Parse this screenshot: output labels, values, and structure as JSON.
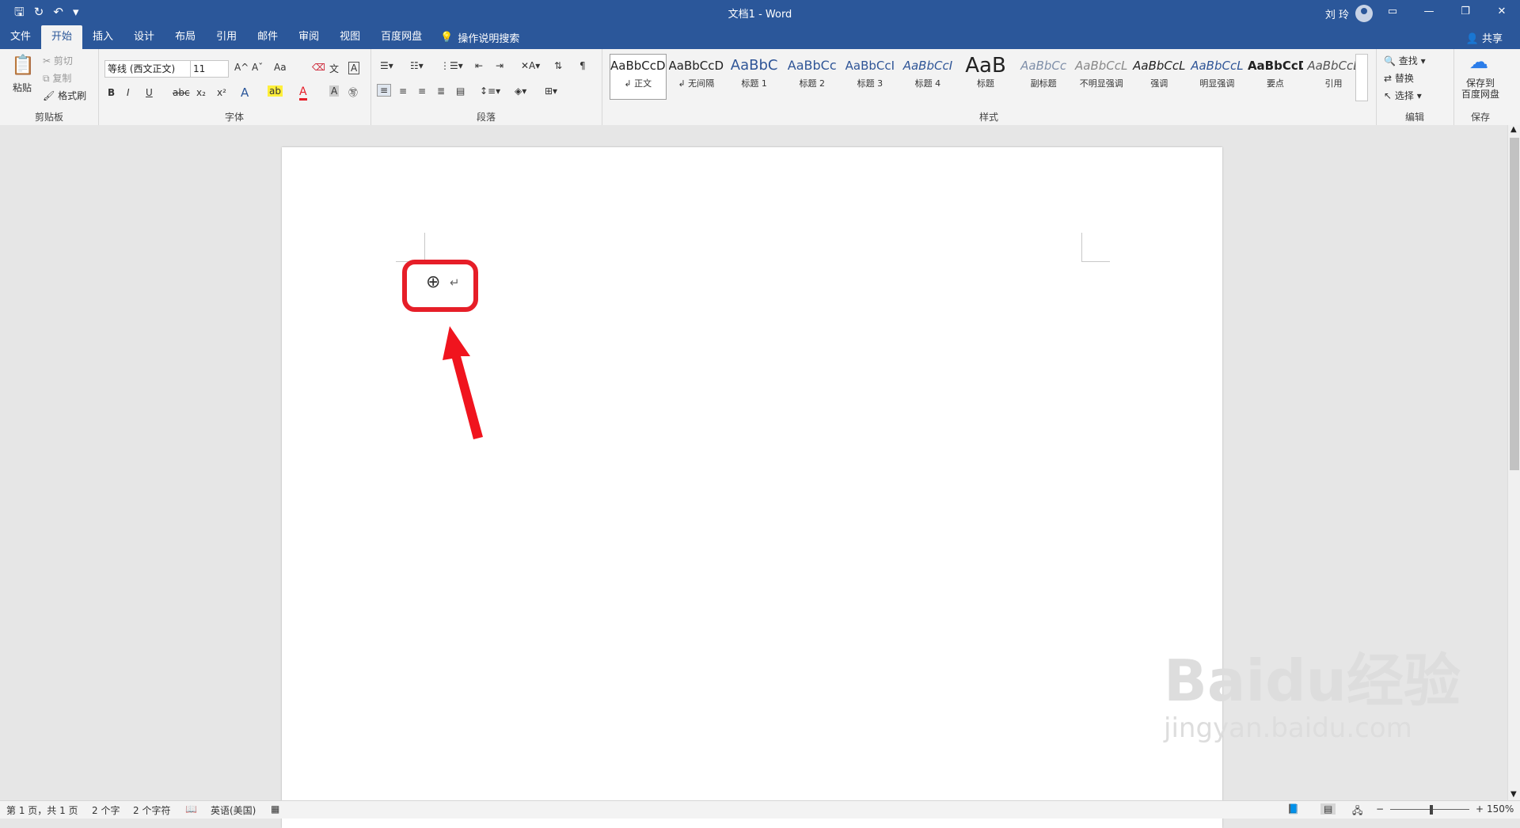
{
  "titlebar": {
    "title": "文档1  -  Word",
    "user": "刘 玲",
    "qat_icons": [
      "save-icon",
      "redo-icon",
      "undo-icon",
      "customize-icon"
    ]
  },
  "tabs": [
    {
      "label": "文件"
    },
    {
      "label": "开始",
      "active": true
    },
    {
      "label": "插入"
    },
    {
      "label": "设计"
    },
    {
      "label": "布局"
    },
    {
      "label": "引用"
    },
    {
      "label": "邮件"
    },
    {
      "label": "审阅"
    },
    {
      "label": "视图"
    },
    {
      "label": "百度网盘"
    }
  ],
  "tell_me": "操作说明搜索",
  "share": "共享",
  "ribbon": {
    "clipboard": {
      "label": "剪贴板",
      "paste": "粘贴",
      "cut": "剪切",
      "copy": "复制",
      "format_painter": "格式刷"
    },
    "font": {
      "label": "字体",
      "font_name": "等线 (西文正文)",
      "font_size": "11",
      "bold": "B",
      "italic": "I",
      "underline": "U",
      "strike": "abc",
      "subscript": "x₂",
      "superscript": "x²",
      "grow": "A^",
      "shrink": "Aˇ",
      "case": "Aa"
    },
    "paragraph": {
      "label": "段落"
    },
    "styles": {
      "label": "样式",
      "items": [
        {
          "sample": "AaBbCcD",
          "name": "↲ 正文",
          "selected": true
        },
        {
          "sample": "AaBbCcD",
          "name": "↲ 无间隔"
        },
        {
          "sample": "AaBbC",
          "name": "标题 1"
        },
        {
          "sample": "AaBbCc",
          "name": "标题 2"
        },
        {
          "sample": "AaBbCcI",
          "name": "标题 3"
        },
        {
          "sample": "AaBbCcI",
          "name": "标题 4"
        },
        {
          "sample": "AaB",
          "name": "标题"
        },
        {
          "sample": "AaBbCc",
          "name": "副标题"
        },
        {
          "sample": "AaBbCcL",
          "name": "不明显强调"
        },
        {
          "sample": "AaBbCcL",
          "name": "强调"
        },
        {
          "sample": "AaBbCcL",
          "name": "明显强调"
        },
        {
          "sample": "AaBbCcD",
          "name": "要点"
        },
        {
          "sample": "AaBbCcL",
          "name": "引用"
        }
      ]
    },
    "editing": {
      "label": "编辑",
      "find": "查找",
      "replace": "替换",
      "select": "选择"
    },
    "save": {
      "label": "保存",
      "save_to_cloud": "保存到\n百度网盘"
    }
  },
  "document": {
    "table_anchor": "⊕",
    "paragraph_mark": "↵"
  },
  "status": {
    "page": "第 1 页，共 1 页",
    "words": "2 个字",
    "chars": "2 个字符",
    "language": "英语(美国)",
    "zoom": "150%"
  },
  "watermark": {
    "brand": "Baidu经验",
    "url": "jingyan.baidu.com"
  },
  "colors": {
    "brand": "#2b579a",
    "highlight": "#e61e28"
  }
}
